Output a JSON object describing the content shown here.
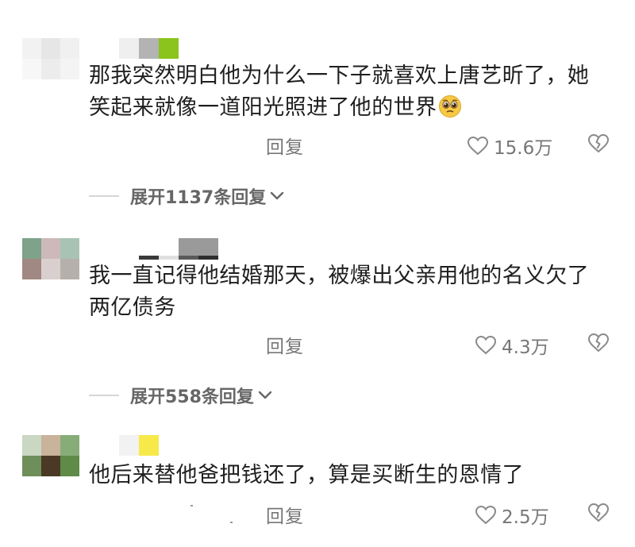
{
  "comments": [
    {
      "text_line1": "那我突然明白他为什么一下子就喜欢上唐艺昕了，她",
      "text_line2": "笑起来就像一道阳光照进了他的世界",
      "emoji_icon": "pleading-face-emoji",
      "reply_label": "回复",
      "likes": "15.6万",
      "expand_label": "展开1137条回复",
      "avatar_colors": [
        "#f2f2f2",
        "#e6e6e6",
        "#f0f0f0",
        "#f7f7f7",
        "#ececec",
        "#f4f4f4"
      ],
      "name_colors": [
        "#efefef",
        "#b3b3b3",
        "#8ac41c"
      ]
    },
    {
      "text_line1": "我一直记得他结婚那天，被爆出父亲用他的名义欠了",
      "text_line2": "两亿债务",
      "reply_label": "回复",
      "likes": "4.3万",
      "expand_label": "展开558条回复",
      "avatar_colors": [
        "#7ea28a",
        "#cdb9ba",
        "#a8c3b4",
        "#a18882",
        "#d9cfcf",
        "#b6b0aa"
      ],
      "name_colors": [
        "#ffffff",
        "#9a9a9a",
        "#3a3a3a",
        "#5a5a5a"
      ]
    },
    {
      "text_line1": "他后来替他爸把钱还了，算是买断生的恩情了",
      "reply_label": "回复",
      "likes": "2.5万",
      "avatar_colors": [
        "#c9d7c3",
        "#c9b39a",
        "#86ad78",
        "#6e8f59",
        "#4a3a25",
        "#5f8a48"
      ],
      "name_colors": [
        "#f2f2f2",
        "#f7e94a"
      ]
    }
  ],
  "colors": {
    "text": "#1f1f1f",
    "meta": "#777777",
    "expand": "#666666",
    "divider": "#d6d6d6"
  },
  "icons": {
    "like": "heart-outline-icon",
    "dislike": "broken-heart-outline-icon",
    "expand": "chevron-down-icon"
  }
}
